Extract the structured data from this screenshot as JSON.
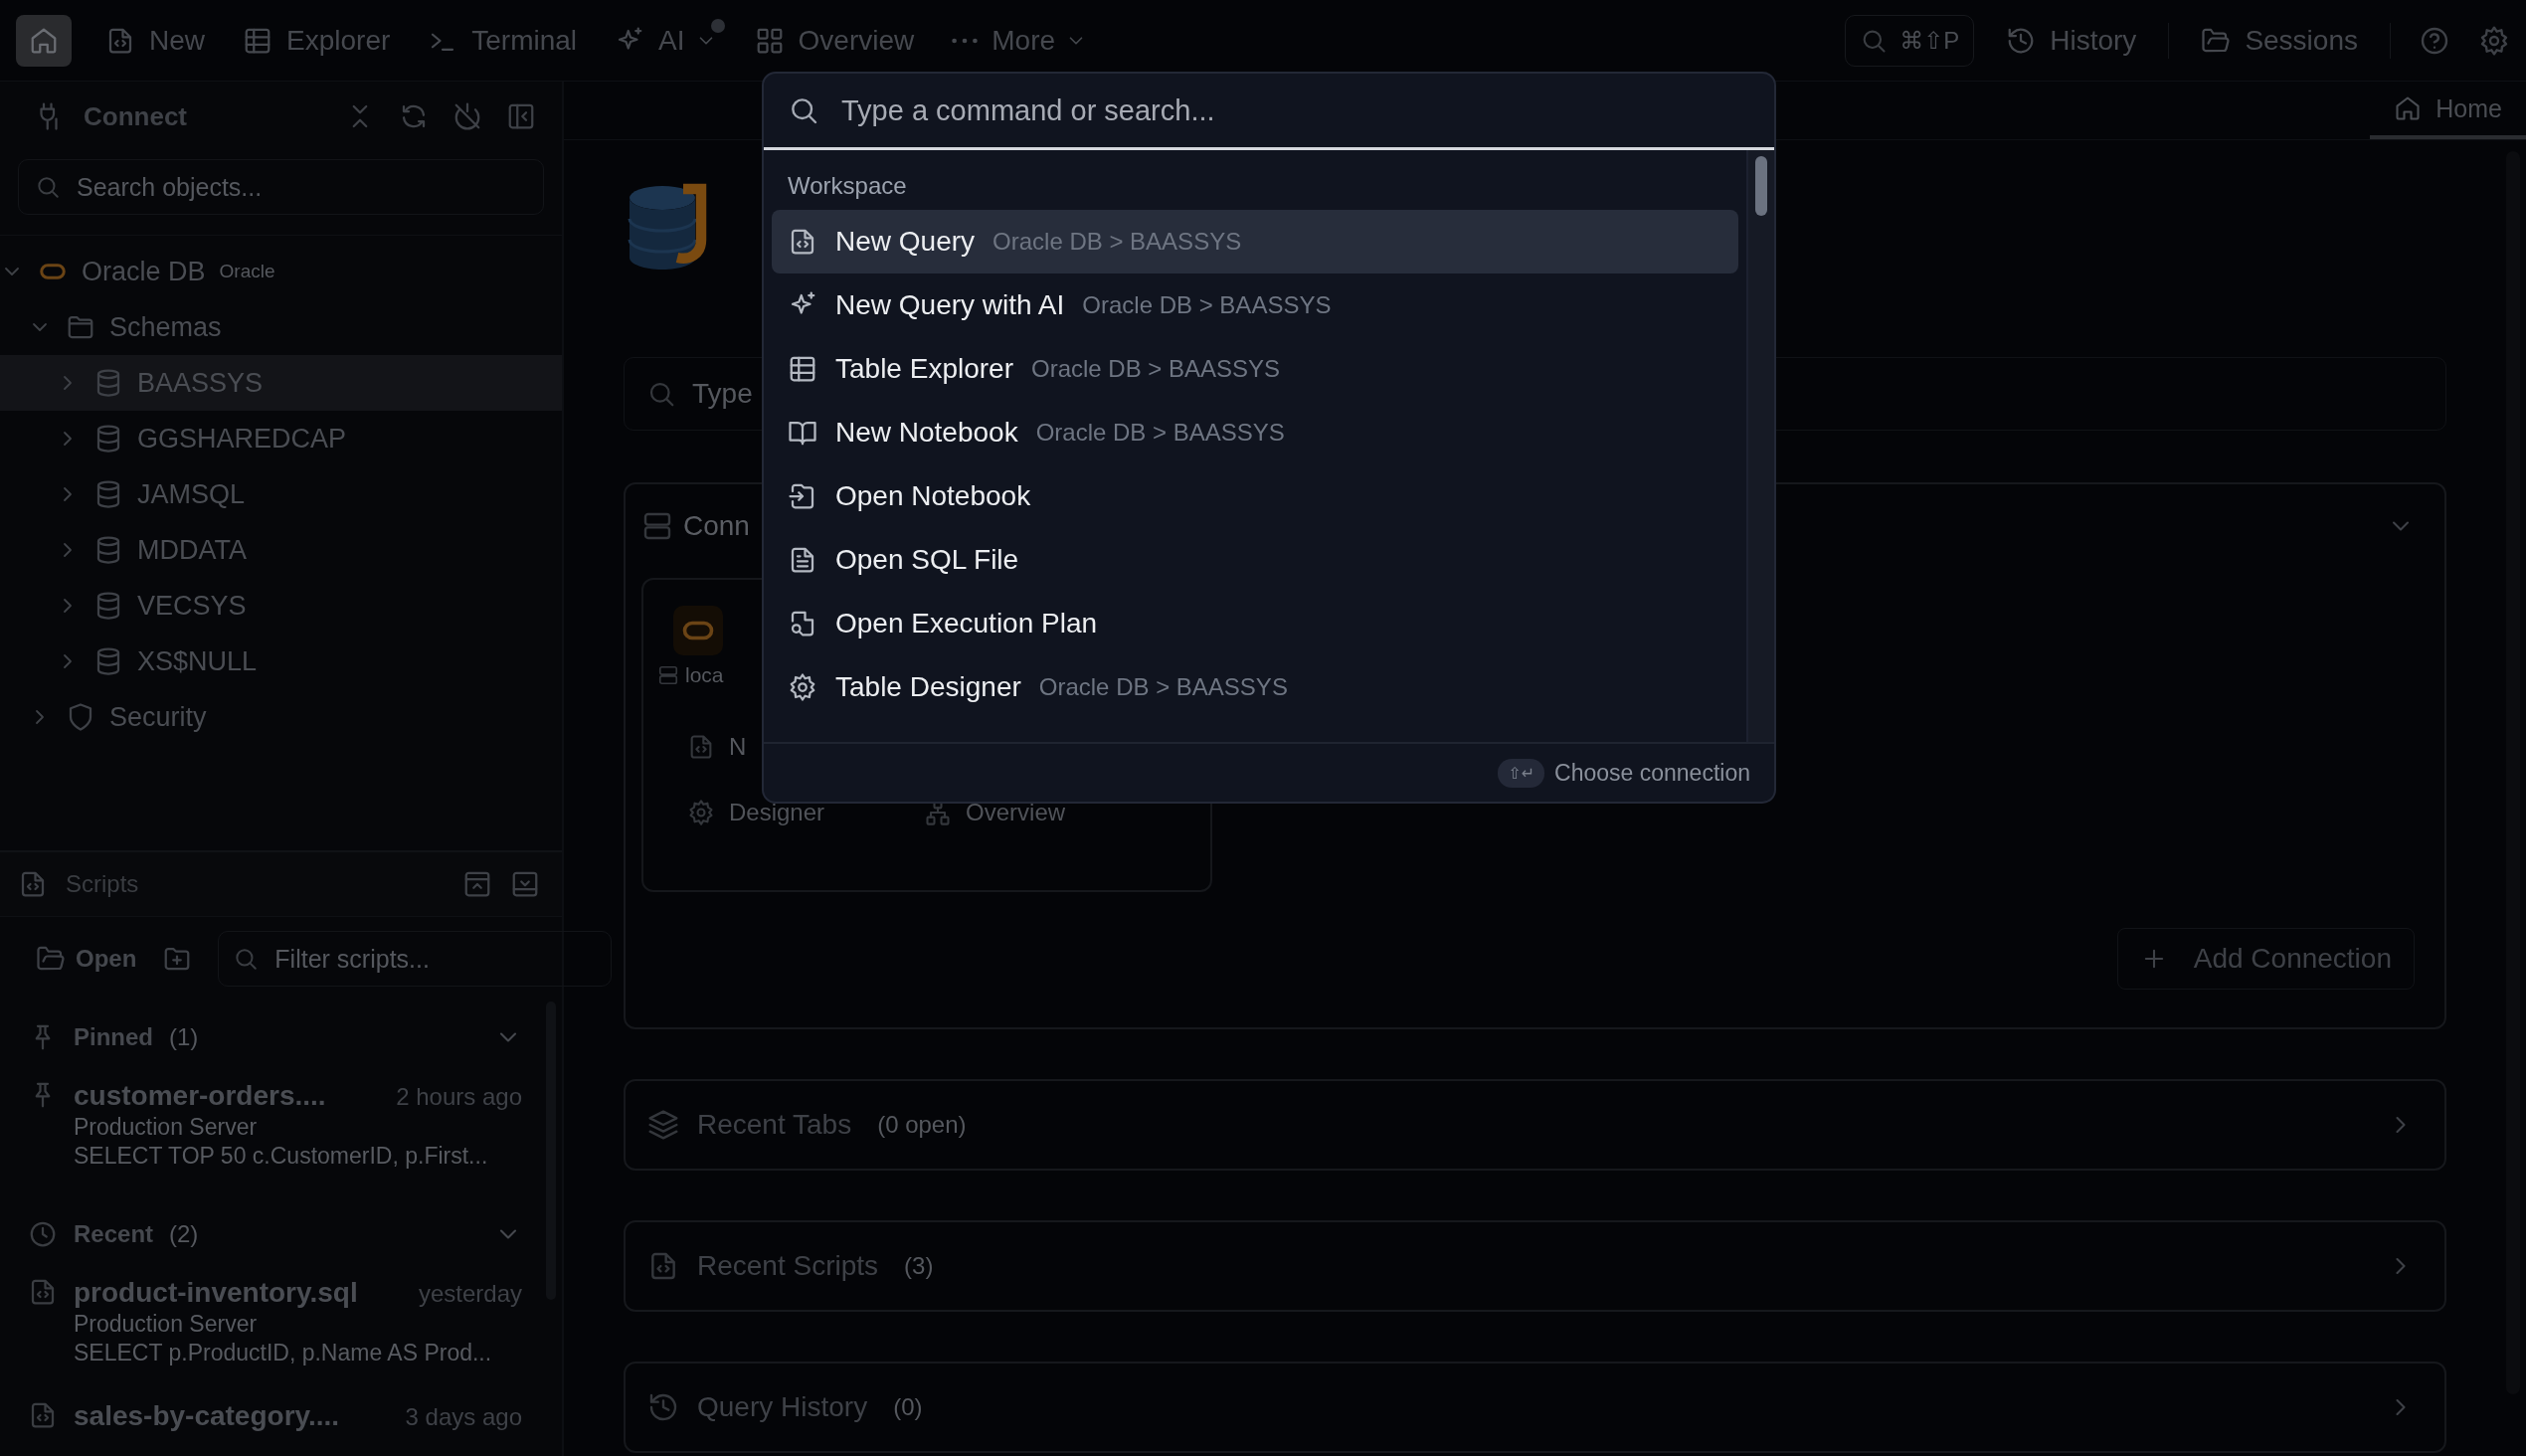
{
  "top_bar": {
    "nav": [
      {
        "kind": "home",
        "selected": true
      },
      {
        "kind": "new",
        "label": "New",
        "selected": false
      },
      {
        "kind": "explorer",
        "label": "Explorer",
        "selected": false
      },
      {
        "kind": "terminal",
        "label": "Terminal",
        "selected": false
      },
      {
        "kind": "ai",
        "label": "AI",
        "selected": false,
        "dropdown": true,
        "badge": true
      },
      {
        "kind": "overview",
        "label": "Overview",
        "selected": false
      },
      {
        "kind": "more",
        "label": "More",
        "selected": false,
        "dropdown": true
      }
    ],
    "shortcut": "⌘⇧P",
    "history": "History",
    "sessions": "Sessions"
  },
  "connect_panel": {
    "title": "Connect",
    "search_placeholder": "Search objects...",
    "tree": [
      {
        "kind": "connection",
        "label": "Oracle DB",
        "tag": "Oracle",
        "expanded": true,
        "selected": false,
        "children": [
          {
            "kind": "folder",
            "label": "Schemas",
            "expanded": true,
            "selected": false,
            "children": [
              {
                "kind": "schema",
                "label": "BAASSYS",
                "expanded": false,
                "selected": true
              },
              {
                "kind": "schema",
                "label": "GGSHAREDCAP",
                "expanded": false,
                "selected": false
              },
              {
                "kind": "schema",
                "label": "JAMSQL",
                "expanded": false,
                "selected": false
              },
              {
                "kind": "schema",
                "label": "MDDATA",
                "expanded": false,
                "selected": false
              },
              {
                "kind": "schema",
                "label": "VECSYS",
                "expanded": false,
                "selected": false
              },
              {
                "kind": "schema",
                "label": "XS$NULL",
                "expanded": false,
                "selected": false
              }
            ]
          },
          {
            "kind": "security",
            "label": "Security",
            "expanded": false,
            "selected": false
          }
        ]
      }
    ]
  },
  "scripts_panel": {
    "title": "Scripts",
    "open_label": "Open",
    "filter_placeholder": "Filter scripts...",
    "groups": [
      {
        "kind": "pinned",
        "label": "Pinned",
        "count": "(1)",
        "expanded": true,
        "items": [
          {
            "kind": "pinned",
            "name": "customer-orders....",
            "time": "2 hours ago",
            "server": "Production Server",
            "preview": "SELECT TOP 50 c.CustomerID, p.First..."
          }
        ]
      },
      {
        "kind": "recent",
        "label": "Recent",
        "count": "(2)",
        "expanded": true,
        "items": [
          {
            "kind": "script",
            "name": "product-inventory.sql",
            "time": "yesterday",
            "server": "Production Server",
            "preview": "SELECT p.ProductID, p.Name AS Prod..."
          },
          {
            "kind": "script",
            "name": "sales-by-category....",
            "time": "3 days ago"
          }
        ]
      }
    ]
  },
  "main": {
    "tab": {
      "label": "Home",
      "selected": true
    },
    "search_placeholder": "Type",
    "connections": {
      "title": "Conn",
      "expanded": true,
      "card": {
        "host": "loca",
        "action": "N",
        "buttons": [
          {
            "kind": "designer",
            "label": "Designer"
          },
          {
            "kind": "overview",
            "label": "Overview"
          }
        ]
      },
      "add_button": "Add Connection"
    },
    "sections": [
      {
        "kind": "tabs",
        "title": "Recent Tabs",
        "count": "(0 open)",
        "expanded": false
      },
      {
        "kind": "scripts",
        "title": "Recent Scripts",
        "count": "(3)",
        "expanded": false
      },
      {
        "kind": "history",
        "title": "Query History",
        "count": "(0)",
        "expanded": false
      }
    ]
  },
  "command_palette": {
    "placeholder": "Type a command or search...",
    "group": "Workspace",
    "items": [
      {
        "kind": "query",
        "label": "New Query",
        "context": "Oracle DB > BAASSYS",
        "selected": true
      },
      {
        "kind": "ai",
        "label": "New Query with AI",
        "context": "Oracle DB > BAASSYS",
        "selected": false
      },
      {
        "kind": "table",
        "label": "Table Explorer",
        "context": "Oracle DB > BAASSYS",
        "selected": false
      },
      {
        "kind": "notebook",
        "label": "New Notebook",
        "context": "Oracle DB > BAASSYS",
        "selected": false
      },
      {
        "kind": "open_notebook",
        "label": "Open Notebook",
        "selected": false
      },
      {
        "kind": "sql_file",
        "label": "Open SQL File",
        "selected": false
      },
      {
        "kind": "plan",
        "label": "Open Execution Plan",
        "selected": false
      },
      {
        "kind": "designer",
        "label": "Table Designer",
        "context": "Oracle DB > BAASSYS",
        "selected": false
      }
    ],
    "footer_key": "⇧↵",
    "footer_label": "Choose connection"
  }
}
